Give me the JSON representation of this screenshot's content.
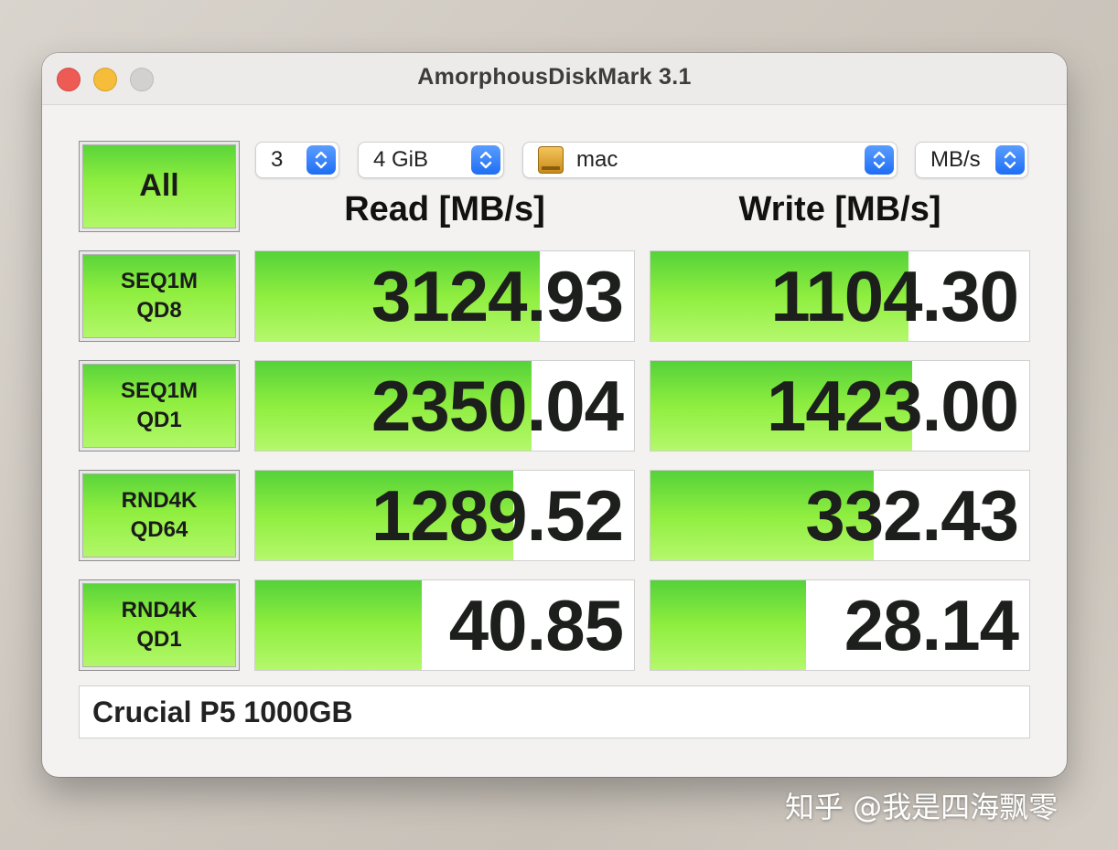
{
  "window": {
    "title": "AmorphousDiskMark 3.1"
  },
  "controls": {
    "all_label": "All",
    "count": "3",
    "size": "4 GiB",
    "drive": "mac",
    "unit": "MB/s"
  },
  "headers": {
    "read": "Read [MB/s]",
    "write": "Write [MB/s]"
  },
  "tests": [
    {
      "line1": "SEQ1M",
      "line2": "QD8",
      "read": "3124.93",
      "read_fill": 0.75,
      "write": "1104.30",
      "write_fill": 0.68
    },
    {
      "line1": "SEQ1M",
      "line2": "QD1",
      "read": "2350.04",
      "read_fill": 0.73,
      "write": "1423.00",
      "write_fill": 0.69
    },
    {
      "line1": "RND4K",
      "line2": "QD64",
      "read": "1289.52",
      "read_fill": 0.68,
      "write": "332.43",
      "write_fill": 0.59
    },
    {
      "line1": "RND4K",
      "line2": "QD1",
      "read": "40.85",
      "read_fill": 0.44,
      "write": "28.14",
      "write_fill": 0.41
    }
  ],
  "info": "Crucial P5 1000GB",
  "watermark": "知乎 @我是四海飘零",
  "colors": {
    "accent_green": "#8fee3f",
    "stepper_blue": "#1e6ef5"
  }
}
